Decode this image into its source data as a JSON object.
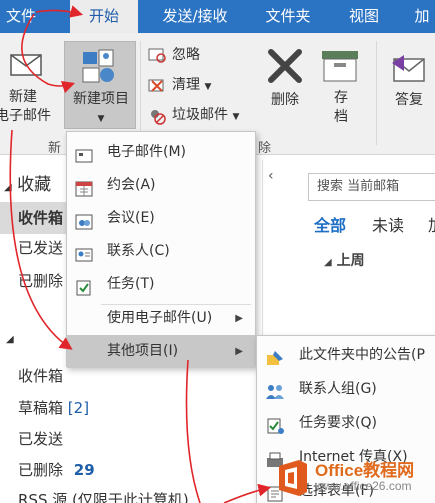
{
  "tabs": [
    {
      "label": "文件",
      "active": false
    },
    {
      "label": "开始",
      "active": true
    },
    {
      "label": "发送/接收",
      "active": false
    },
    {
      "label": "文件夹",
      "active": false
    },
    {
      "label": "视图",
      "active": false
    },
    {
      "label": "加",
      "active": false
    }
  ],
  "ribbon": {
    "new_email": [
      "新建",
      "电子邮件"
    ],
    "new_item": "新建项目",
    "ignore": "忽略",
    "clean": "清理",
    "junk": "垃圾邮件",
    "delete": "删除",
    "archive": [
      "存",
      "档"
    ],
    "reply": "答复",
    "group_new": "新",
    "group_delete": "除"
  },
  "folder_pane": {
    "favorites": "收藏",
    "inbox": "收件箱",
    "sent": "已发送",
    "deleted": "已删除",
    "account_inbox": "收件箱",
    "drafts": "草稿箱",
    "drafts_count": "[2]",
    "account_sent": "已发送",
    "account_deleted": "已删除",
    "deleted_count": "29",
    "rss": "RSS 源 (仅限于此计算机)"
  },
  "list": {
    "search_placeholder": "搜索 当前邮箱",
    "filter_all": "全部",
    "filter_unread": "未读",
    "filter_more": "加",
    "group_header": "上周"
  },
  "new_item_menu": [
    {
      "label": "电子邮件(M)",
      "icon": "email-icon"
    },
    {
      "label": "约会(A)",
      "icon": "calendar-icon"
    },
    {
      "label": "会议(E)",
      "icon": "meeting-icon"
    },
    {
      "label": "联系人(C)",
      "icon": "contact-card-icon"
    },
    {
      "label": "任务(T)",
      "icon": "task-icon"
    },
    {
      "label": "使用电子邮件(U)",
      "icon": ""
    },
    {
      "label": "其他项目(I)",
      "icon": ""
    }
  ],
  "submenu": [
    {
      "label": "此文件夹中的公告(P",
      "icon": "pin-icon"
    },
    {
      "label": "联系人组(G)",
      "icon": "contact-group-icon"
    },
    {
      "label": "任务要求(Q)",
      "icon": "task-request-icon"
    },
    {
      "label": "Internet 传真(X)",
      "icon": "fax-icon"
    },
    {
      "label": "选择表单(F)",
      "icon": "form-icon"
    }
  ],
  "watermark": {
    "title": "Office教程网",
    "url": "www.office26.com"
  },
  "colors": {
    "tab_blue": "#2b73c3",
    "arrow_red": "#e0262a",
    "brand_orange": "#e06b1e"
  }
}
